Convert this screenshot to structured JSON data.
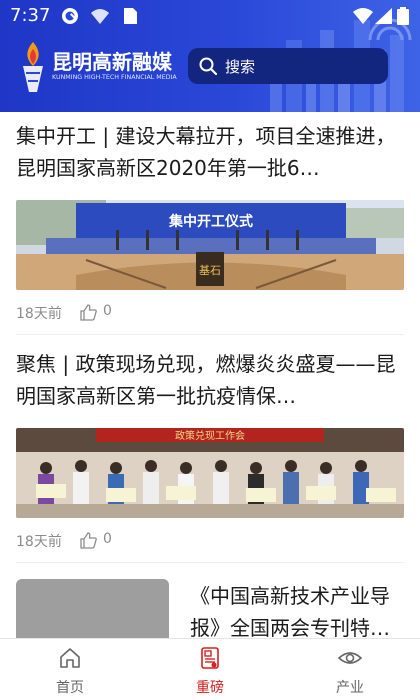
{
  "status_bar": {
    "time": "7:37"
  },
  "header": {
    "brand_name": "昆明高新融媒",
    "brand_sub": "KUNMING HIGH-TECH FINANCIAL MEDIA",
    "search_placeholder": "搜索"
  },
  "feed": [
    {
      "title": "集中开工 | 建设大幕拉开，项目全速推进，昆明国家高新区2020年第一批6…",
      "image_banner_text": "集中开工仪式",
      "image_stone_text": "基石",
      "time_ago": "18天前",
      "likes": "0"
    },
    {
      "title": "聚焦 | 政策现场兑现，燃爆炎炎盛夏——昆明国家高新区第一批抗疫情保…",
      "image_banner_text": "政策兑现工作会",
      "time_ago": "18天前",
      "likes": "0"
    },
    {
      "title": "《中国高新技术产业导报》全国两会专刊特…"
    }
  ],
  "tabs": [
    {
      "label": "首页",
      "icon": "home-icon",
      "active": false
    },
    {
      "label": "重磅",
      "icon": "news-icon",
      "active": true
    },
    {
      "label": "产业",
      "icon": "eye-icon",
      "active": false
    }
  ],
  "colors": {
    "header_blue": "#2a48d8",
    "search_bg": "#12257f",
    "active_tab": "#d81e1e"
  }
}
